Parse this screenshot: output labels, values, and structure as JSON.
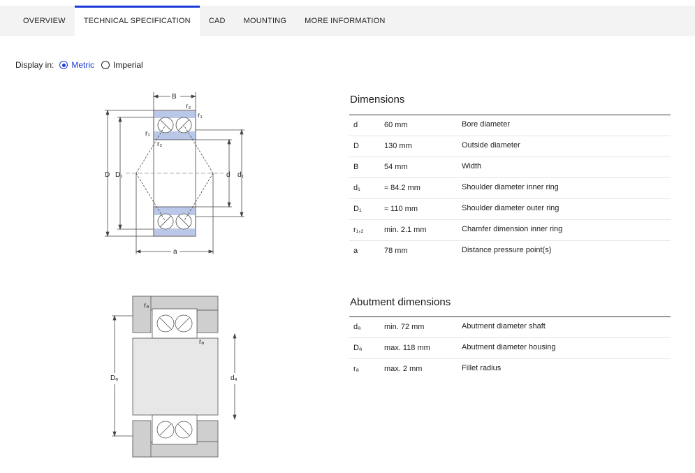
{
  "tabs": [
    {
      "label": "OVERVIEW",
      "active": false
    },
    {
      "label": "TECHNICAL SPECIFICATION",
      "active": true
    },
    {
      "label": "CAD",
      "active": false
    },
    {
      "label": "MOUNTING",
      "active": false
    },
    {
      "label": "MORE INFORMATION",
      "active": false
    }
  ],
  "display": {
    "label": "Display in:",
    "options": [
      {
        "label": "Metric",
        "selected": true
      },
      {
        "label": "Imperial",
        "selected": false
      }
    ]
  },
  "dimensions": {
    "title": "Dimensions",
    "rows": [
      {
        "symbol": "d",
        "value": "60 mm",
        "description": "Bore diameter"
      },
      {
        "symbol": "D",
        "value": "130 mm",
        "description": "Outside diameter"
      },
      {
        "symbol": "B",
        "value": "54 mm",
        "description": "Width"
      },
      {
        "symbol": "d₁",
        "value": "≈ 84.2 mm",
        "description": "Shoulder diameter inner ring"
      },
      {
        "symbol": "D₁",
        "value": "≈ 110 mm",
        "description": "Shoulder diameter outer ring"
      },
      {
        "symbol": "r₁,₂",
        "value": "min. 2.1 mm",
        "description": "Chamfer dimension inner ring"
      },
      {
        "symbol": "a",
        "value": "78 mm",
        "description": "Distance pressure point(s)"
      }
    ]
  },
  "abutment": {
    "title": "Abutment dimensions",
    "rows": [
      {
        "symbol": "dₐ",
        "value": "min. 72 mm",
        "description": "Abutment diameter shaft"
      },
      {
        "symbol": "Dₐ",
        "value": "max. 118 mm",
        "description": "Abutment diameter housing"
      },
      {
        "symbol": "rₐ",
        "value": "max. 2 mm",
        "description": "Fillet radius"
      }
    ]
  },
  "diagram1_labels": {
    "B": "B",
    "r2_top": "r₂",
    "r1_top": "r₁",
    "r1_left": "r₁",
    "r2_left": "r₂",
    "D": "D",
    "D1": "D₁",
    "d": "d",
    "d1": "d₁",
    "a": "a"
  },
  "diagram2_labels": {
    "ra_top": "rₐ",
    "ra_mid": "rₐ",
    "Da": "Dₐ",
    "da": "dₐ"
  },
  "colors": {
    "accent": "#1c3ad8",
    "ring_fill": "#b9c8e8",
    "housing_fill": "#cfcfcf"
  }
}
